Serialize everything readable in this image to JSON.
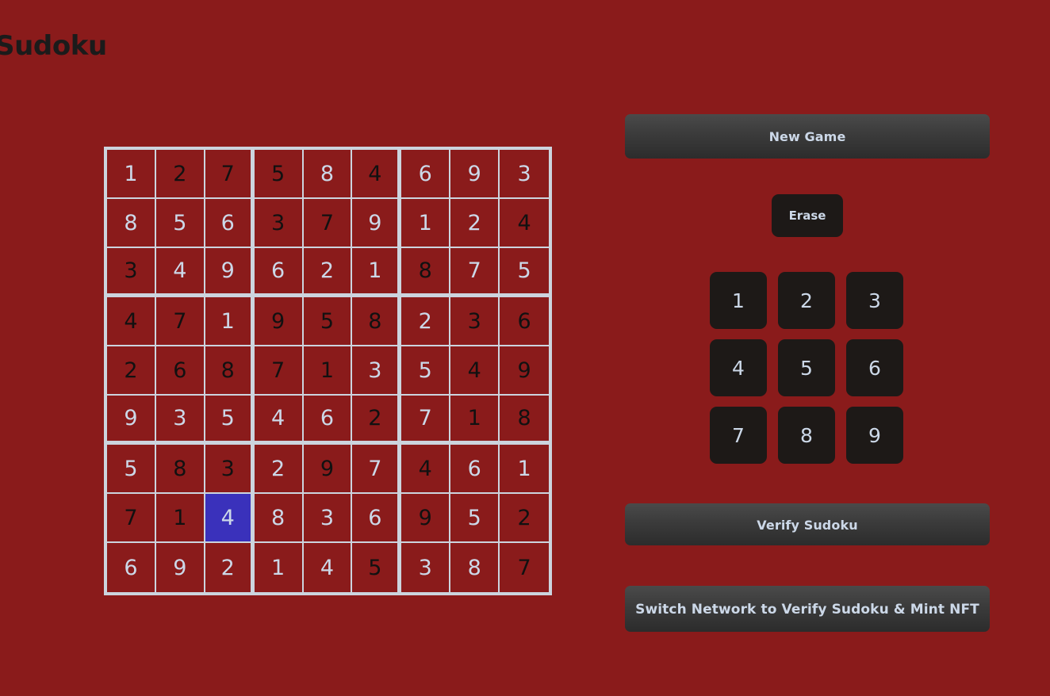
{
  "page": {
    "title": "Sudoku",
    "background_color": "#8a1b1b"
  },
  "colors": {
    "background": "#8a1b1b",
    "grid_line": "#ccd4de",
    "given_digit": "#111111",
    "filled_digit": "#ccd8e8",
    "selected_cell": "#3a31bb",
    "button_dark": "#1d1917",
    "button_gradient_top": "#4a4a4a",
    "button_gradient_bottom": "#2c2c2c",
    "title_text": "#1b1b1b"
  },
  "board": {
    "size": 9,
    "selected_cell": {
      "row": 7,
      "col": 2
    },
    "rows": [
      [
        {
          "value": "1",
          "state": "filled"
        },
        {
          "value": "2",
          "state": "given"
        },
        {
          "value": "7",
          "state": "given"
        },
        {
          "value": "5",
          "state": "given"
        },
        {
          "value": "8",
          "state": "filled"
        },
        {
          "value": "4",
          "state": "given"
        },
        {
          "value": "6",
          "state": "filled"
        },
        {
          "value": "9",
          "state": "filled"
        },
        {
          "value": "3",
          "state": "filled"
        }
      ],
      [
        {
          "value": "8",
          "state": "filled"
        },
        {
          "value": "5",
          "state": "filled"
        },
        {
          "value": "6",
          "state": "filled"
        },
        {
          "value": "3",
          "state": "given"
        },
        {
          "value": "7",
          "state": "given"
        },
        {
          "value": "9",
          "state": "filled"
        },
        {
          "value": "1",
          "state": "filled"
        },
        {
          "value": "2",
          "state": "filled"
        },
        {
          "value": "4",
          "state": "given"
        }
      ],
      [
        {
          "value": "3",
          "state": "given"
        },
        {
          "value": "4",
          "state": "filled"
        },
        {
          "value": "9",
          "state": "filled"
        },
        {
          "value": "6",
          "state": "filled"
        },
        {
          "value": "2",
          "state": "filled"
        },
        {
          "value": "1",
          "state": "filled"
        },
        {
          "value": "8",
          "state": "given"
        },
        {
          "value": "7",
          "state": "filled"
        },
        {
          "value": "5",
          "state": "filled"
        }
      ],
      [
        {
          "value": "4",
          "state": "given"
        },
        {
          "value": "7",
          "state": "given"
        },
        {
          "value": "1",
          "state": "filled"
        },
        {
          "value": "9",
          "state": "given"
        },
        {
          "value": "5",
          "state": "given"
        },
        {
          "value": "8",
          "state": "given"
        },
        {
          "value": "2",
          "state": "filled"
        },
        {
          "value": "3",
          "state": "given"
        },
        {
          "value": "6",
          "state": "given"
        }
      ],
      [
        {
          "value": "2",
          "state": "given"
        },
        {
          "value": "6",
          "state": "given"
        },
        {
          "value": "8",
          "state": "given"
        },
        {
          "value": "7",
          "state": "given"
        },
        {
          "value": "1",
          "state": "given"
        },
        {
          "value": "3",
          "state": "filled"
        },
        {
          "value": "5",
          "state": "filled"
        },
        {
          "value": "4",
          "state": "given"
        },
        {
          "value": "9",
          "state": "given"
        }
      ],
      [
        {
          "value": "9",
          "state": "filled"
        },
        {
          "value": "3",
          "state": "filled"
        },
        {
          "value": "5",
          "state": "filled"
        },
        {
          "value": "4",
          "state": "filled"
        },
        {
          "value": "6",
          "state": "filled"
        },
        {
          "value": "2",
          "state": "given"
        },
        {
          "value": "7",
          "state": "filled"
        },
        {
          "value": "1",
          "state": "given"
        },
        {
          "value": "8",
          "state": "given"
        }
      ],
      [
        {
          "value": "5",
          "state": "filled"
        },
        {
          "value": "8",
          "state": "given"
        },
        {
          "value": "3",
          "state": "given"
        },
        {
          "value": "2",
          "state": "filled"
        },
        {
          "value": "9",
          "state": "given"
        },
        {
          "value": "7",
          "state": "filled"
        },
        {
          "value": "4",
          "state": "given"
        },
        {
          "value": "6",
          "state": "filled"
        },
        {
          "value": "1",
          "state": "filled"
        }
      ],
      [
        {
          "value": "7",
          "state": "given"
        },
        {
          "value": "1",
          "state": "given"
        },
        {
          "value": "4",
          "state": "selected"
        },
        {
          "value": "8",
          "state": "filled"
        },
        {
          "value": "3",
          "state": "filled"
        },
        {
          "value": "6",
          "state": "filled"
        },
        {
          "value": "9",
          "state": "given"
        },
        {
          "value": "5",
          "state": "filled"
        },
        {
          "value": "2",
          "state": "given"
        }
      ],
      [
        {
          "value": "6",
          "state": "filled"
        },
        {
          "value": "9",
          "state": "filled"
        },
        {
          "value": "2",
          "state": "filled"
        },
        {
          "value": "1",
          "state": "filled"
        },
        {
          "value": "4",
          "state": "filled"
        },
        {
          "value": "5",
          "state": "given"
        },
        {
          "value": "3",
          "state": "filled"
        },
        {
          "value": "8",
          "state": "filled"
        },
        {
          "value": "7",
          "state": "given"
        }
      ]
    ]
  },
  "controls": {
    "new_game_label": "New Game",
    "erase_label": "Erase",
    "numpad": [
      "1",
      "2",
      "3",
      "4",
      "5",
      "6",
      "7",
      "8",
      "9"
    ],
    "verify_label": "Verify Sudoku",
    "switch_network_label": "Switch Network to Verify Sudoku & Mint NFT"
  }
}
